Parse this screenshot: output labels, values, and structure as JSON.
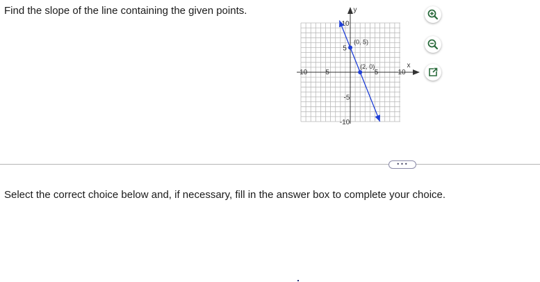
{
  "question": {
    "text": "Find the slope of the line containing the given points."
  },
  "graph": {
    "x_axis_label": "x",
    "y_axis_label": "y",
    "tick_labels": {
      "x_neg10": "-10",
      "x_neg5": "-5",
      "x_5": "5",
      "x_10": "10",
      "y_10": "10",
      "y_5": "5",
      "y_neg5": "-5",
      "y_neg10": "-10"
    },
    "points": [
      {
        "label": "(0, 5)",
        "x": 0,
        "y": 5
      },
      {
        "label": "(2, 0)",
        "x": 2,
        "y": 0
      }
    ],
    "range": {
      "xmin": -10,
      "xmax": 10,
      "ymin": -10,
      "ymax": 10
    },
    "line_color": "#1f3fd6",
    "point_color": "#1f3fd6"
  },
  "tools": {
    "zoom_in_icon": "zoom-in-icon",
    "zoom_out_icon": "zoom-out-icon",
    "popout_icon": "popout-icon"
  },
  "more_button": {
    "label": "•••"
  },
  "instruction": {
    "text": "Select the correct choice below and, if necessary, fill in the answer box to complete your choice."
  },
  "colors": {
    "accent": "#1f3fd6",
    "tool_icon": "#2a6b3c",
    "divider": "#b5b5b5"
  }
}
